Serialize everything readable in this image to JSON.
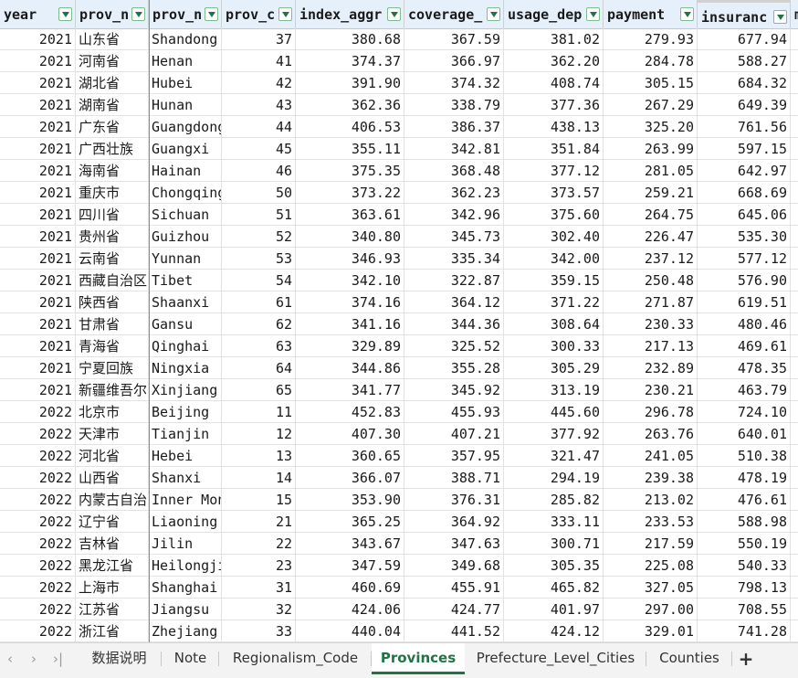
{
  "columns": [
    "year",
    "prov_n",
    "prov_n",
    "prov_c",
    "index_aggr",
    "coverage_",
    "usage_dep",
    "payment",
    "insuranc",
    "m"
  ],
  "rows": [
    [
      "2021",
      "山东省",
      "Shandong",
      "37",
      "380.68",
      "367.59",
      "381.02",
      "279.93",
      "677.94"
    ],
    [
      "2021",
      "河南省",
      "Henan",
      "41",
      "374.37",
      "366.97",
      "362.20",
      "284.78",
      "588.27"
    ],
    [
      "2021",
      "湖北省",
      "Hubei",
      "42",
      "391.90",
      "374.32",
      "408.74",
      "305.15",
      "684.32"
    ],
    [
      "2021",
      "湖南省",
      "Hunan",
      "43",
      "362.36",
      "338.79",
      "377.36",
      "267.29",
      "649.39"
    ],
    [
      "2021",
      "广东省",
      "Guangdong",
      "44",
      "406.53",
      "386.37",
      "438.13",
      "325.20",
      "761.56"
    ],
    [
      "2021",
      "广西壮族",
      "Guangxi",
      "45",
      "355.11",
      "342.81",
      "351.84",
      "263.99",
      "597.15"
    ],
    [
      "2021",
      "海南省",
      "Hainan",
      "46",
      "375.35",
      "368.48",
      "377.12",
      "281.05",
      "642.97"
    ],
    [
      "2021",
      "重庆市",
      "Chongqing",
      "50",
      "373.22",
      "362.23",
      "373.57",
      "259.21",
      "668.69"
    ],
    [
      "2021",
      "四川省",
      "Sichuan",
      "51",
      "363.61",
      "342.96",
      "375.60",
      "264.75",
      "645.06"
    ],
    [
      "2021",
      "贵州省",
      "Guizhou",
      "52",
      "340.80",
      "345.73",
      "302.40",
      "226.47",
      "535.30"
    ],
    [
      "2021",
      "云南省",
      "Yunnan",
      "53",
      "346.93",
      "335.34",
      "342.00",
      "237.12",
      "577.12"
    ],
    [
      "2021",
      "西藏自治区",
      "Tibet",
      "54",
      "342.10",
      "322.87",
      "359.15",
      "250.48",
      "576.90"
    ],
    [
      "2021",
      "陕西省",
      "Shaanxi",
      "61",
      "374.16",
      "364.12",
      "371.22",
      "271.87",
      "619.51"
    ],
    [
      "2021",
      "甘肃省",
      "Gansu",
      "62",
      "341.16",
      "344.36",
      "308.64",
      "230.33",
      "480.46"
    ],
    [
      "2021",
      "青海省",
      "Qinghai",
      "63",
      "329.89",
      "325.52",
      "300.33",
      "217.13",
      "469.61"
    ],
    [
      "2021",
      "宁夏回族",
      "Ningxia",
      "64",
      "344.86",
      "355.28",
      "305.29",
      "232.89",
      "478.35"
    ],
    [
      "2021",
      "新疆维吾尔",
      "Xinjiang",
      "65",
      "341.77",
      "345.92",
      "313.19",
      "230.21",
      "463.79"
    ],
    [
      "2022",
      "北京市",
      "Beijing",
      "11",
      "452.83",
      "455.93",
      "445.60",
      "296.78",
      "724.10"
    ],
    [
      "2022",
      "天津市",
      "Tianjin",
      "12",
      "407.30",
      "407.21",
      "377.92",
      "263.76",
      "640.01"
    ],
    [
      "2022",
      "河北省",
      "Hebei",
      "13",
      "360.65",
      "357.95",
      "321.47",
      "241.05",
      "510.38"
    ],
    [
      "2022",
      "山西省",
      "Shanxi",
      "14",
      "366.07",
      "388.71",
      "294.19",
      "239.38",
      "478.19"
    ],
    [
      "2022",
      "内蒙古自治",
      "Inner Mongolia",
      "15",
      "353.90",
      "376.31",
      "285.82",
      "213.02",
      "476.61"
    ],
    [
      "2022",
      "辽宁省",
      "Liaoning",
      "21",
      "365.25",
      "364.92",
      "333.11",
      "233.53",
      "588.98"
    ],
    [
      "2022",
      "吉林省",
      "Jilin",
      "22",
      "343.67",
      "347.63",
      "300.71",
      "217.59",
      "550.19"
    ],
    [
      "2022",
      "黑龙江省",
      "Heilongjiang",
      "23",
      "347.59",
      "349.68",
      "305.35",
      "225.08",
      "540.33"
    ],
    [
      "2022",
      "上海市",
      "Shanghai",
      "31",
      "460.69",
      "455.91",
      "465.82",
      "327.05",
      "798.13"
    ],
    [
      "2022",
      "江苏省",
      "Jiangsu",
      "32",
      "424.06",
      "424.77",
      "401.97",
      "297.00",
      "708.55"
    ],
    [
      "2022",
      "浙江省",
      "Zhejiang",
      "33",
      "440.04",
      "441.52",
      "424.12",
      "329.01",
      "741.28"
    ]
  ],
  "tabs": [
    "数据说明",
    "Note",
    "Regionalism_Code",
    "Provinces",
    "Prefecture_Level_Cities",
    "Counties"
  ],
  "active_tab": "Provinces",
  "colors": {
    "accent": "#217346",
    "header_bg": "#e6f0fa",
    "freeze_line": "#5aa876"
  }
}
